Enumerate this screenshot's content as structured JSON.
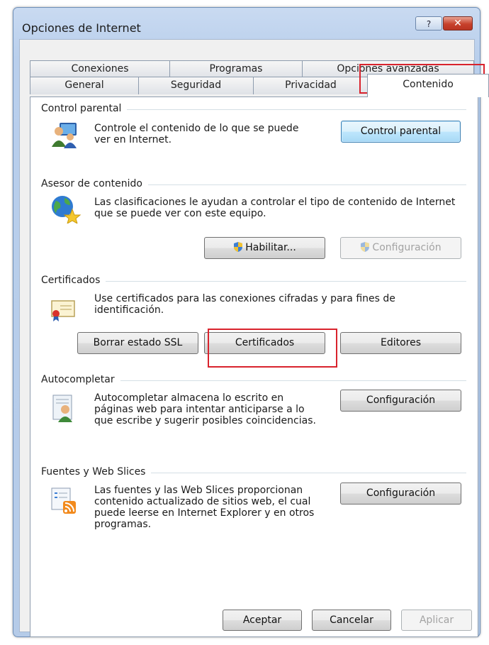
{
  "window": {
    "title": "Opciones de Internet",
    "help_label": "?",
    "close_label": "✕"
  },
  "tabs": {
    "row1": [
      "Conexiones",
      "Programas",
      "Opciones avanzadas"
    ],
    "row2": [
      "General",
      "Seguridad",
      "Privacidad",
      "Contenido"
    ],
    "active": "Contenido"
  },
  "parental": {
    "group": "Control parental",
    "description": "Controle el contenido de lo que se puede ver en Internet.",
    "button": "Control parental"
  },
  "advisor": {
    "group": "Asesor de contenido",
    "description": "Las clasificaciones le ayudan a controlar el tipo de contenido de Internet que se puede ver con este equipo.",
    "enable_button": "Habilitar...",
    "settings_button": "Configuración"
  },
  "certificates": {
    "group": "Certificados",
    "description": "Use certificados para las conexiones cifradas y para fines de identificación.",
    "clear_ssl_button": "Borrar estado SSL",
    "certificates_button": "Certificados",
    "publishers_button": "Editores"
  },
  "autocomplete": {
    "group": "Autocompletar",
    "description": "Autocompletar almacena lo escrito en páginas web para intentar anticiparse a lo que escribe y sugerir posibles coincidencias.",
    "settings_button": "Configuración"
  },
  "feeds": {
    "group": "Fuentes y Web Slices",
    "description": "Las fuentes y las Web Slices proporcionan contenido actualizado de sitios web, el cual puede leerse en Internet Explorer y en otros programas.",
    "settings_button": "Configuración"
  },
  "footer": {
    "ok": "Aceptar",
    "cancel": "Cancelar",
    "apply": "Aplicar"
  },
  "colors": {
    "highlight": "#d9232d",
    "title_bar": "#c9daf1",
    "focus_button": "#bee6fd"
  }
}
